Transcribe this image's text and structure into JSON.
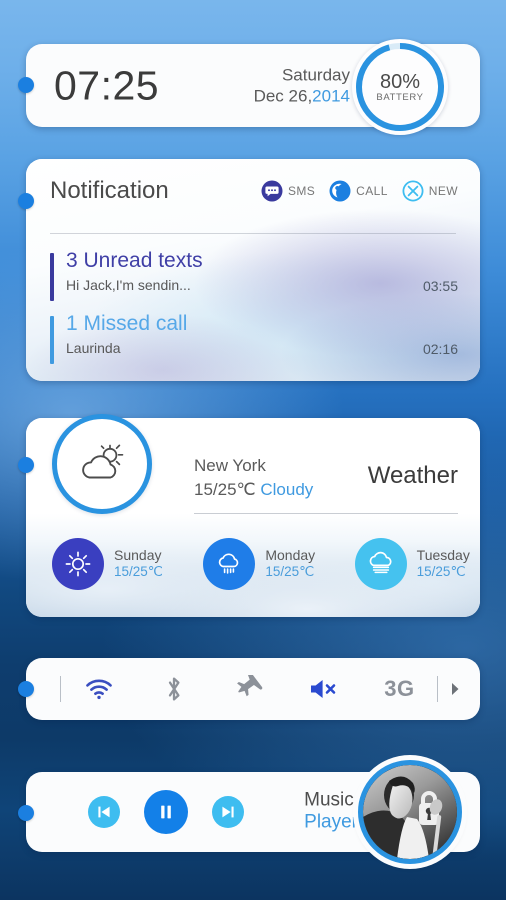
{
  "theme": {
    "accent_blue": "#1b7fe0",
    "ring_blue": "#2a93e0",
    "light_cyan": "#3ebdf0",
    "indigo": "#3a4ec0",
    "gray_icon": "#8c9199"
  },
  "clock": {
    "time": "07:25",
    "weekday": "Saturday",
    "date_prefix": "Dec 26,",
    "date_year": "2014",
    "battery_percent": "80%",
    "battery_label": "BATTERY",
    "battery_value": 80
  },
  "notification": {
    "title": "Notification",
    "shortcuts": [
      {
        "icon": "sms-bubble-icon",
        "label": "SMS"
      },
      {
        "icon": "call-phone-icon",
        "label": "CALL"
      },
      {
        "icon": "new-close-icon",
        "label": "NEW"
      }
    ],
    "items": [
      {
        "title": "3 Unread texts",
        "subtitle": "Hi Jack,I'm sendin...",
        "time": "03:55",
        "color": "#3f3fa6",
        "bar_color": "#3a3a9e"
      },
      {
        "title": "1 Missed call",
        "subtitle": "Laurinda",
        "time": "02:16",
        "color": "#56a8e8",
        "bar_color": "#3f9ae0"
      }
    ]
  },
  "weather": {
    "label": "Weather",
    "city": "New York",
    "temp": "15/25℃",
    "condition": "Cloudy",
    "current_icon": "sun-behind-cloud-icon",
    "forecast": [
      {
        "day": "Sunday",
        "temp": "15/25℃",
        "icon": "sun-icon",
        "color": "#3a3fc0"
      },
      {
        "day": "Monday",
        "temp": "15/25℃",
        "icon": "rain-cloud-icon",
        "color": "#1f7de8"
      },
      {
        "day": "Tuesday",
        "temp": "15/25℃",
        "icon": "fog-cloud-icon",
        "color": "#45c2ef"
      }
    ]
  },
  "toggles": [
    {
      "name": "wifi",
      "icon": "wifi-icon",
      "label": "",
      "state": "on",
      "color": "#3a4ec0"
    },
    {
      "name": "bluetooth",
      "icon": "bluetooth-icon",
      "label": "",
      "state": "off",
      "color": "#8c9199"
    },
    {
      "name": "airplane",
      "icon": "airplane-icon",
      "label": "",
      "state": "off",
      "color": "#8c9199"
    },
    {
      "name": "mute",
      "icon": "mute-icon",
      "label": "",
      "state": "on",
      "color": "#2a4ad0"
    },
    {
      "name": "network",
      "icon": "network-text",
      "label": "3G",
      "state": "off",
      "color": "#8c9199"
    },
    {
      "name": "more",
      "icon": "chevron-right-icon",
      "label": "",
      "state": "off",
      "color": "#6d7278"
    }
  ],
  "music": {
    "line1": "Music",
    "line2": "Player",
    "buttons": [
      {
        "name": "previous",
        "icon": "skip-previous-icon"
      },
      {
        "name": "pause",
        "icon": "pause-icon"
      },
      {
        "name": "next",
        "icon": "skip-next-icon"
      }
    ],
    "album_art": "singer-with-microphone-photo"
  }
}
